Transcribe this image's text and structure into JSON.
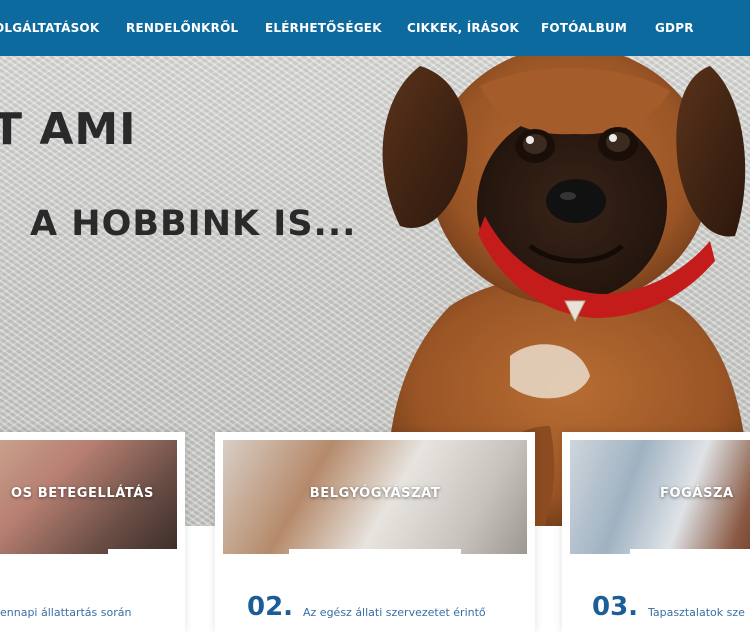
{
  "nav": {
    "items": [
      {
        "label": "OLGÁLTATÁSOK"
      },
      {
        "label": "RENDELŐNKRŐL"
      },
      {
        "label": "ELÉRHETŐSÉGEK"
      },
      {
        "label": "CIKKEK, ÍRÁSOK"
      },
      {
        "label": "FOTÓALBUM"
      },
      {
        "label": "GDPR"
      }
    ]
  },
  "hero": {
    "line1": "T AMI",
    "line2": "A HOBBINK IS..."
  },
  "cards": [
    {
      "title": "OS BETEGELLÁTÁS",
      "number": "",
      "text": "ennapi állattartás során"
    },
    {
      "title": "BELGYÓGYÁSZAT",
      "number": "02.",
      "text": "Az egész állati szervezetet érintő"
    },
    {
      "title": "FOGÁSZA",
      "number": "03.",
      "text": "Tapasztalatok  sze"
    }
  ],
  "colors": {
    "nav_bg": "#0d6a9e",
    "accent_number": "#1b5e97"
  }
}
